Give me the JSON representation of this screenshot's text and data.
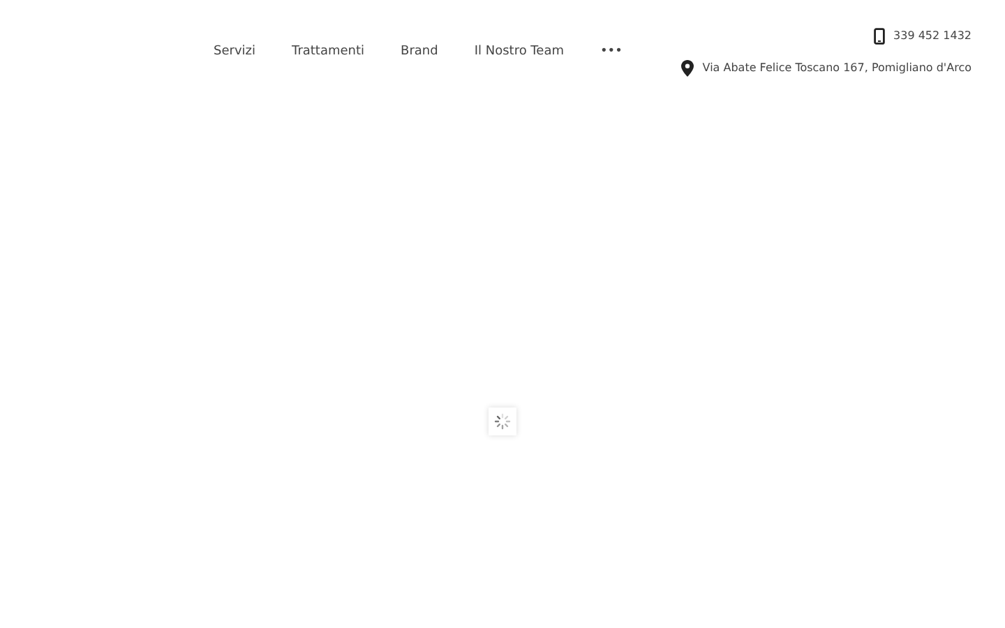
{
  "nav": {
    "items": [
      {
        "label": "Servizi"
      },
      {
        "label": "Trattamenti"
      },
      {
        "label": "Brand"
      },
      {
        "label": "Il Nostro Team"
      },
      {
        "label": "•••"
      }
    ]
  },
  "contact": {
    "phone": "339 452 1432",
    "address": "Via Abate Felice Toscano 167, Pomigliano d'Arco"
  }
}
